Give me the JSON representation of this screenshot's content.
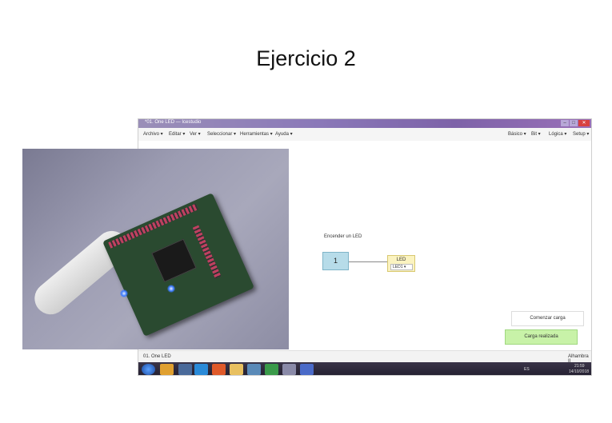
{
  "slide": {
    "title": "Ejercicio 2"
  },
  "window": {
    "title": "*01. One LED — Icestudio"
  },
  "menu": {
    "left": [
      "Archivo ▾",
      "Editar ▾",
      "Ver ▾",
      "Seleccionar ▾",
      "Herramientas ▾",
      "Ayuda ▾"
    ],
    "right": [
      "Básico ▾",
      "Bit ▾",
      "Lógica ▾",
      "Setup ▾"
    ]
  },
  "canvas": {
    "comment": "Encender un LED",
    "constant_value": "1",
    "led_block": {
      "title": "LED",
      "select_value": "LED1"
    }
  },
  "actions": {
    "start_upload": "Comenzar carga",
    "upload_done": "Carga realizada"
  },
  "status": {
    "left": "01. One LED",
    "right": "Alhambra II"
  },
  "taskbar": {
    "lang": "ES",
    "time": "21:59",
    "date": "14/10/2018"
  },
  "colors": {
    "titlebar": "#8a78b8",
    "constant": "#b7dce9",
    "led": "#fbf3c0",
    "done": "#c8f2a8",
    "taskbar": "#2b2638"
  }
}
